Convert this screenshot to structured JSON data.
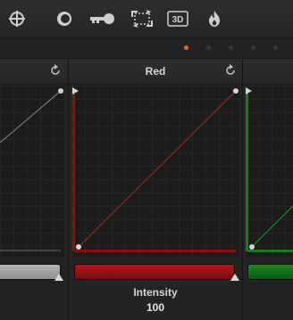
{
  "toolbar": {
    "tools": [
      {
        "name": "crosshair-icon"
      },
      {
        "name": "circle-mask-icon"
      },
      {
        "name": "key-icon"
      },
      {
        "name": "tracker-icon"
      },
      {
        "name": "3d-icon",
        "label": "3D"
      },
      {
        "name": "flame-icon"
      }
    ]
  },
  "pager": {
    "pages": 5,
    "active_page": 1
  },
  "panels": {
    "left": {
      "title": "",
      "color": "#9a9a9a"
    },
    "red": {
      "title": "Red",
      "color": "#a30f12"
    },
    "green": {
      "title": "",
      "color": "#0f6b12"
    }
  },
  "intensity": {
    "label": "Intensity",
    "value": "100"
  },
  "colors": {
    "accent_orange": "#e0701c",
    "red_curve": "#b5272b",
    "green_curve": "#1e9a22",
    "gray_curve": "#9a9a9a"
  }
}
